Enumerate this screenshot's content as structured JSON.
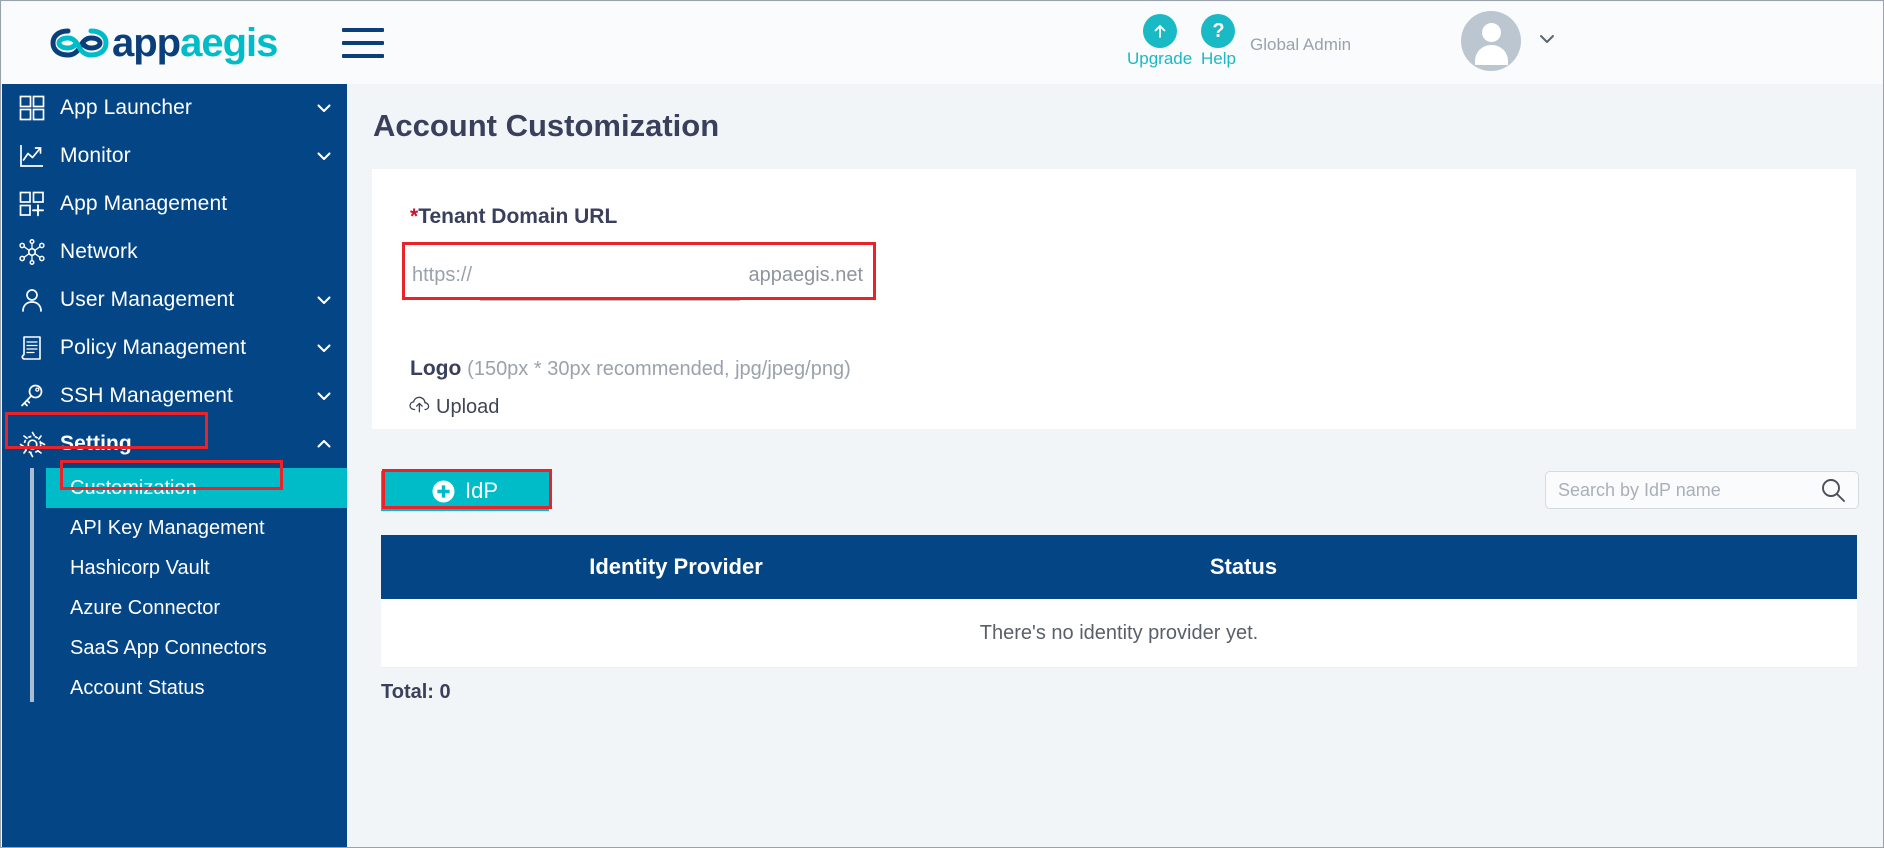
{
  "header": {
    "logo": {
      "text_primary": "app",
      "text_accent": "aegis",
      "mark": "infinity-logo"
    },
    "menu_toggle": "hamburger-menu",
    "upgrade": {
      "label": "Upgrade",
      "icon": "up-arrow-icon"
    },
    "help": {
      "label": "Help",
      "icon": "question-mark-icon"
    },
    "user_role": "Global Admin",
    "avatar": "user-avatar",
    "caret": "chevron-down-icon"
  },
  "sidebar": {
    "items": [
      {
        "label": "App Launcher",
        "icon": "grid-icon",
        "caret": "down"
      },
      {
        "label": "Monitor",
        "icon": "chart-line-icon",
        "caret": "down"
      },
      {
        "label": "App Management",
        "icon": "grid-plus-icon",
        "caret": "none"
      },
      {
        "label": "Network",
        "icon": "network-nodes-icon",
        "caret": "none"
      },
      {
        "label": "User Management",
        "icon": "user-icon",
        "caret": "down"
      },
      {
        "label": "Policy Management",
        "icon": "document-icon",
        "caret": "down"
      },
      {
        "label": "SSH Management",
        "icon": "key-icon",
        "caret": "down"
      },
      {
        "label": "Setting",
        "icon": "gear-icon",
        "caret": "up",
        "active": true
      }
    ],
    "submenu": [
      {
        "label": "Customization",
        "selected": true
      },
      {
        "label": "API Key Management",
        "selected": false
      },
      {
        "label": "Hashicorp Vault",
        "selected": false
      },
      {
        "label": "Azure Connector",
        "selected": false
      },
      {
        "label": "SaaS App Connectors",
        "selected": false
      },
      {
        "label": "Account Status",
        "selected": false
      }
    ]
  },
  "main": {
    "page_title": "Account Customization",
    "tenant_domain": {
      "required_mark": "*",
      "label": "Tenant Domain URL",
      "prefix": "https://",
      "value": "",
      "placeholder": "",
      "suffix": "appaegis.net"
    },
    "logo_section": {
      "label": "Logo",
      "hint": "(150px * 30px recommended, jpg/jpeg/png)",
      "upload_label": "Upload",
      "upload_icon": "cloud-upload-icon"
    },
    "idp_button": {
      "label": "IdP",
      "icon": "plus-circle-icon"
    },
    "search": {
      "placeholder": "Search by IdP name",
      "value": "",
      "icon": "search-icon"
    },
    "table": {
      "columns": [
        "Identity Provider",
        "Status"
      ],
      "rows": [],
      "empty_message": "There's no identity provider yet.",
      "total_label": "Total: 0"
    }
  },
  "colors": {
    "navy": "#044585",
    "teal": "#00bcc8",
    "annotation_red": "#e8232a",
    "required_red": "#c8102e",
    "page_bg": "#f2f5f8"
  }
}
